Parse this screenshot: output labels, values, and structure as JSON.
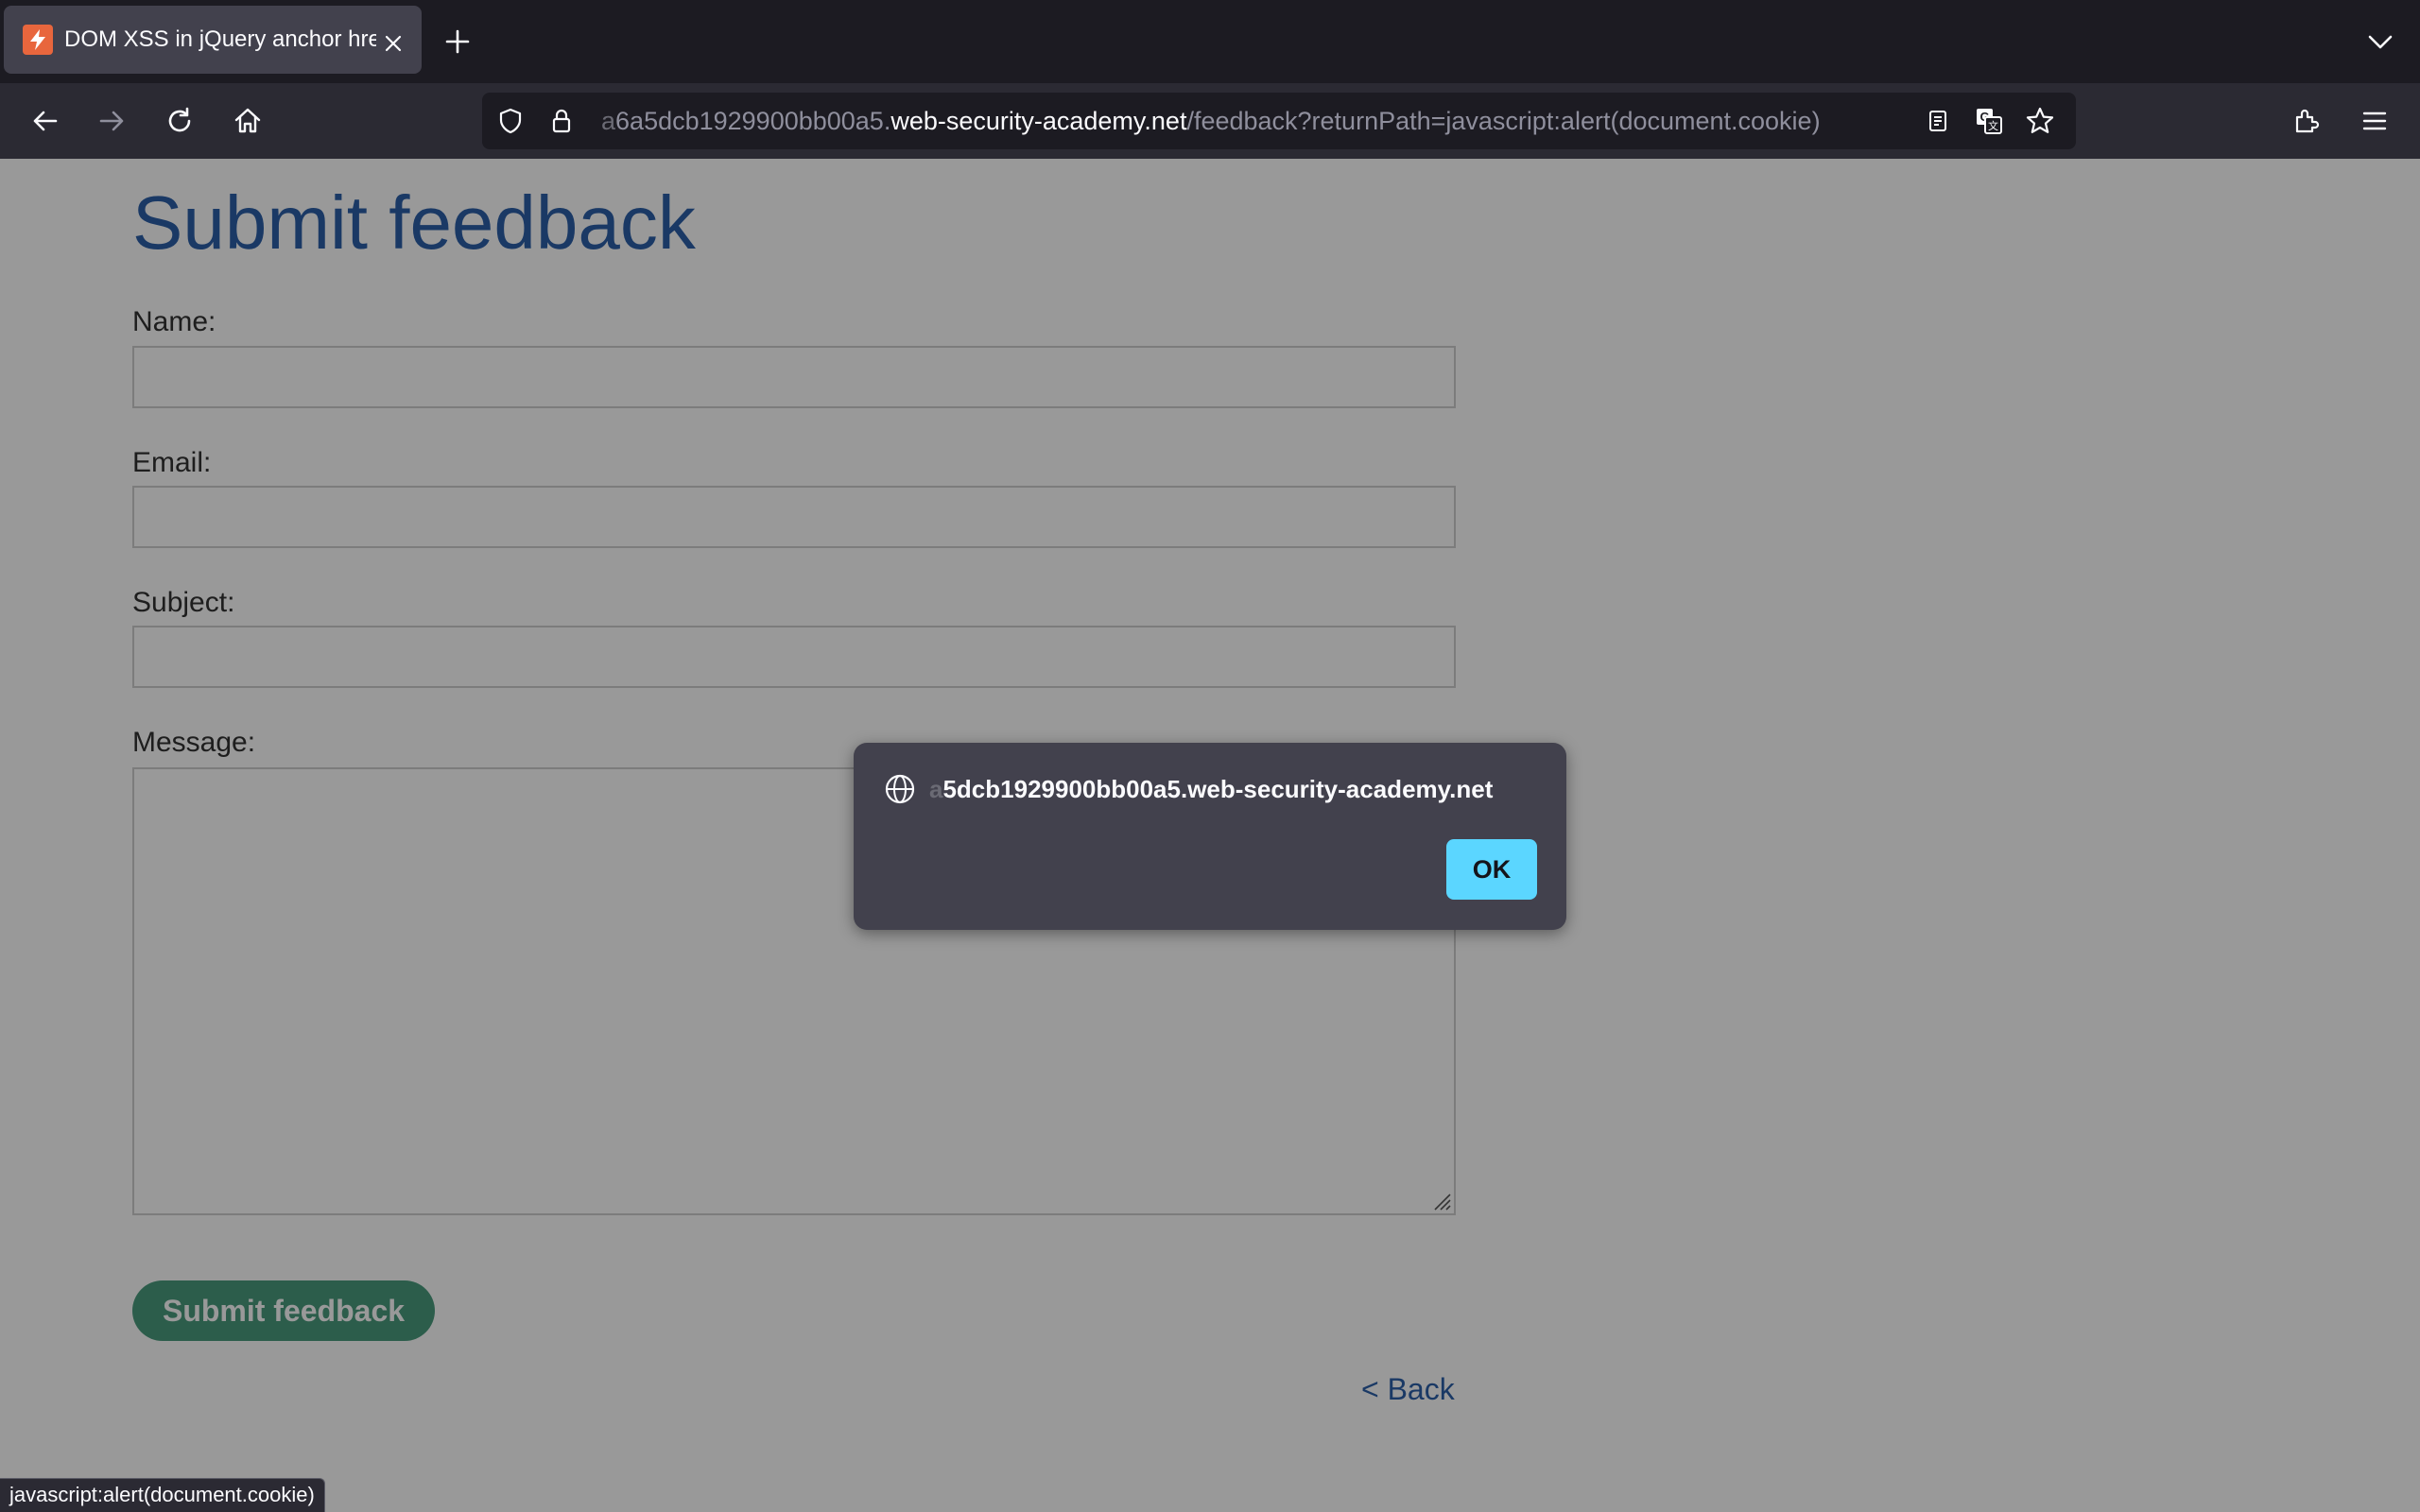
{
  "browser": {
    "tab": {
      "title": "DOM XSS in jQuery anchor href",
      "favicon": "lightning-icon"
    },
    "url": {
      "prefix_faded": "a",
      "prefix": "6a5dcb1929900bb00a5.",
      "host": "web-security-academy.net",
      "path": "/feedback?returnPath=javascript:alert(document.cookie)"
    },
    "status_text": "javascript:alert(document.cookie)"
  },
  "page": {
    "title": "Submit feedback",
    "fields": {
      "name_label": "Name:",
      "email_label": "Email:",
      "subject_label": "Subject:",
      "message_label": "Message:",
      "name_value": "",
      "email_value": "",
      "subject_value": "",
      "message_value": ""
    },
    "submit_label": "Submit feedback",
    "back_label": "< Back"
  },
  "dialog": {
    "origin_faded": "a",
    "origin": "5dcb1929900bb00a5.web-security-academy.net",
    "ok_label": "OK"
  },
  "colors": {
    "accent_blue": "#2c5fa8",
    "submit_green": "#4a9c7e",
    "ok_button": "#5bd6ff"
  }
}
